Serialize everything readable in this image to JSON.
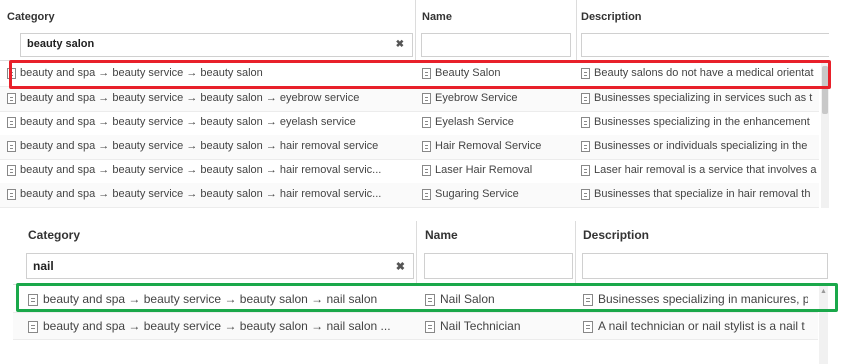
{
  "columns": {
    "category": "Category",
    "name": "Name",
    "description": "Description"
  },
  "panel1": {
    "filter": {
      "category": "beauty salon",
      "name": "",
      "description": ""
    },
    "clear_glyph": "✖",
    "rows": [
      {
        "category": "beauty and spa → beauty service → beauty salon",
        "name": "Beauty Salon",
        "description": "Beauty salons do not have a medical orientat"
      },
      {
        "category": "beauty and spa → beauty service → beauty salon → eyebrow service",
        "name": "Eyebrow Service",
        "description": "Businesses specializing in services such as t"
      },
      {
        "category": "beauty and spa → beauty service → beauty salon → eyelash service",
        "name": "Eyelash Service",
        "description": "Businesses specializing in the enhancement"
      },
      {
        "category": "beauty and spa → beauty service → beauty salon → hair removal service",
        "name": "Hair Removal Service",
        "description": "Businesses or individuals specializing in the"
      },
      {
        "category": "beauty and spa → beauty service → beauty salon → hair removal servic...",
        "name": "Laser Hair Removal",
        "description": "Laser hair removal is a service that involves a"
      },
      {
        "category": "beauty and spa → beauty service → beauty salon → hair removal servic...",
        "name": "Sugaring Service",
        "description": "Businesses that specialize in hair removal th"
      }
    ],
    "highlight_color": "#e8202a"
  },
  "panel2": {
    "filter": {
      "category": "nail",
      "name": "",
      "description": ""
    },
    "clear_glyph": "✖",
    "rows": [
      {
        "category": "beauty and spa → beauty service → beauty salon → nail salon",
        "name": "Nail Salon",
        "description": "Businesses specializing in manicures, p"
      },
      {
        "category": "beauty and spa → beauty service → beauty salon → nail salon ...",
        "name": "Nail Technician",
        "description": "A nail technician or nail stylist is a nail t"
      }
    ],
    "highlight_color": "#1aa84a",
    "scroll_up_glyph": "▲"
  },
  "icons": {
    "row_icon": "document-icon"
  }
}
